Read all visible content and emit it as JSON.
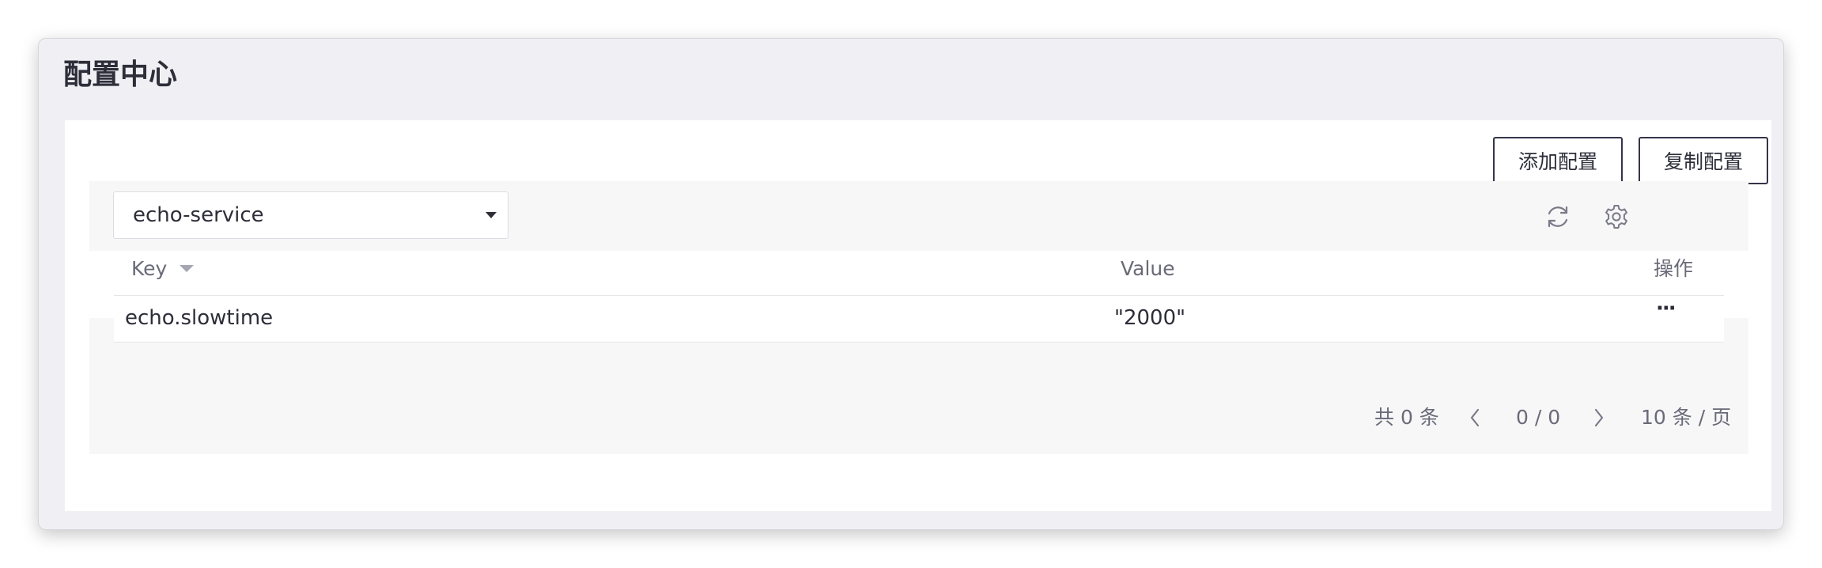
{
  "page": {
    "title": "配置中心"
  },
  "toolbar": {
    "add_label": "添加配置",
    "copy_label": "复制配置"
  },
  "filter": {
    "selected_service": "echo-service"
  },
  "table": {
    "columns": [
      "Key",
      "Value",
      "操作"
    ],
    "rows": [
      {
        "key": "echo.slowtime",
        "value": "\"2000\"",
        "op": "···"
      }
    ]
  },
  "pagination": {
    "total": "共 0 条",
    "page": "0 / 0",
    "page_size": "10 条 / 页"
  },
  "icons": {
    "refresh": "refresh-icon",
    "settings": "gear-icon",
    "sort": "caret-down-icon",
    "prev": "chevron-left-icon",
    "next": "chevron-right-icon"
  },
  "colors": {
    "window_bg": "#f0f0f4",
    "card_bg": "#ffffff",
    "bar_bg": "#f7f7f8",
    "text": "#2e2e3a",
    "muted": "#6a6a78"
  }
}
